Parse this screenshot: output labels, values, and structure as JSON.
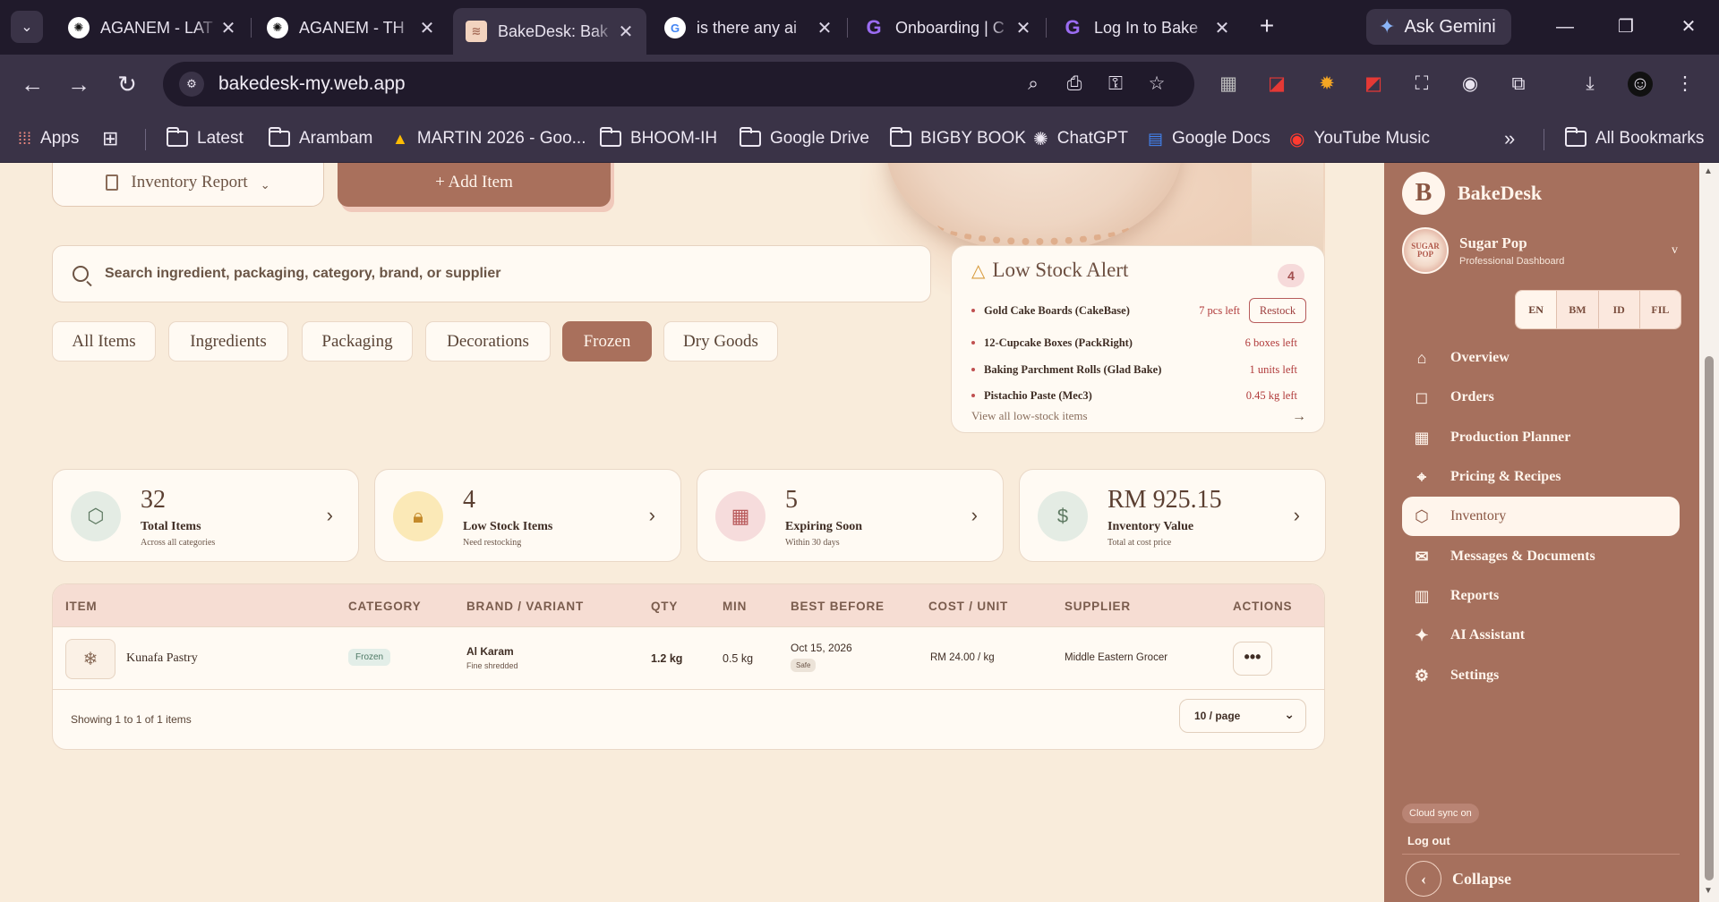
{
  "browser": {
    "tabs": [
      {
        "title": "AGANEM - LAT"
      },
      {
        "title": "AGANEM - TH"
      },
      {
        "title": "BakeDesk: Bak"
      },
      {
        "title": "is there any ai"
      },
      {
        "title": "Onboarding | C"
      },
      {
        "title": "Log In to Bake"
      }
    ],
    "ask_gemini": "Ask Gemini",
    "url": "bakedesk-my.web.app",
    "bookmarks": [
      "Apps",
      "Latest",
      "Arambam",
      "MARTIN 2026 - Goo...",
      "BHOOM-IH",
      "Google Drive",
      "BIGBY BOOK",
      "ChatGPT",
      "Google Docs",
      "YouTube Music"
    ],
    "all_bookmarks": "All Bookmarks"
  },
  "toolbar": {
    "inventory_report": "Inventory Report",
    "add_item": "+ Add Item"
  },
  "search": {
    "placeholder": "Search ingredient, packaging, category, brand, or supplier"
  },
  "filters": [
    "All Items",
    "Ingredients",
    "Packaging",
    "Decorations",
    "Frozen",
    "Dry Goods"
  ],
  "low_stock": {
    "title": "Low Stock Alert",
    "count": "4",
    "items": [
      {
        "name": "Gold Cake Boards (CakeBase)",
        "level": "7 pcs left",
        "action": "Restock"
      },
      {
        "name": "12-Cupcake Boxes (PackRight)",
        "level": "6 boxes left"
      },
      {
        "name": "Baking Parchment Rolls (Glad Bake)",
        "level": "1 units left"
      },
      {
        "name": "Pistachio Paste (Mec3)",
        "level": "0.45 kg left"
      }
    ],
    "view_all": "View all low-stock items"
  },
  "stats": [
    {
      "value": "32",
      "label": "Total Items",
      "sub": "Across all categories"
    },
    {
      "value": "4",
      "label": "Low Stock Items",
      "sub": "Need restocking"
    },
    {
      "value": "5",
      "label": "Expiring Soon",
      "sub": "Within 30 days"
    },
    {
      "value": "RM 925.15",
      "label": "Inventory Value",
      "sub": "Total at cost price"
    }
  ],
  "table": {
    "headers": [
      "ITEM",
      "CATEGORY",
      "BRAND / VARIANT",
      "QTY",
      "MIN",
      "BEST BEFORE",
      "COST / UNIT",
      "SUPPLIER",
      "ACTIONS"
    ],
    "rows": [
      {
        "item": "Kunafa Pastry",
        "category": "Frozen",
        "brand": "Al Karam",
        "variant": "Fine shredded",
        "qty": "1.2 kg",
        "min": "0.5 kg",
        "best_before": "Oct 15, 2026",
        "status": "Safe",
        "cost": "RM 24.00 / kg",
        "supplier": "Middle Eastern Grocer"
      }
    ],
    "showing": "Showing 1 to 1 of 1 items",
    "page_size": "10 / page"
  },
  "sidebar": {
    "brand": "BakeDesk",
    "brand_initial": "B",
    "profile_name": "Sugar Pop",
    "profile_sub": "Professional Dashboard",
    "languages": [
      "EN",
      "BM",
      "ID",
      "FIL"
    ],
    "nav": [
      {
        "label": "Overview"
      },
      {
        "label": "Orders"
      },
      {
        "label": "Production Planner"
      },
      {
        "label": "Pricing & Recipes"
      },
      {
        "label": "Inventory"
      },
      {
        "label": "Messages & Documents"
      },
      {
        "label": "Reports"
      },
      {
        "label": "AI Assistant"
      },
      {
        "label": "Settings"
      }
    ],
    "cloud_sync": "Cloud sync on",
    "logout": "Log out",
    "collapse": "Collapse"
  }
}
